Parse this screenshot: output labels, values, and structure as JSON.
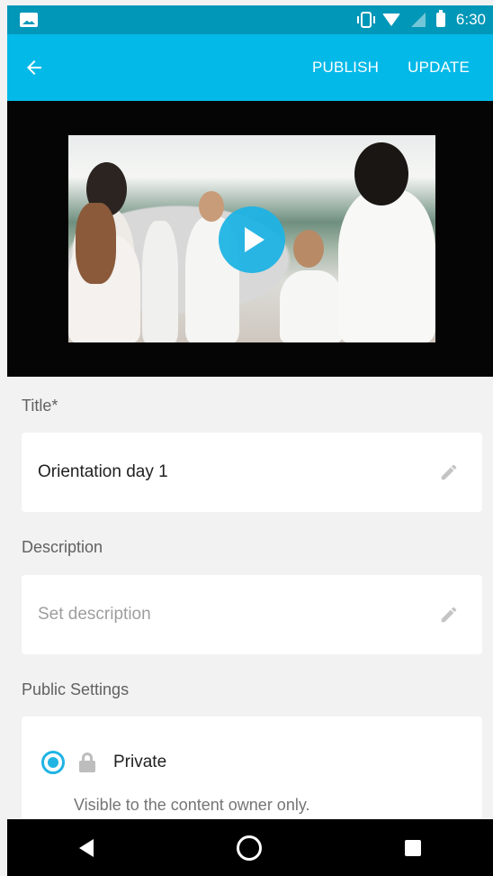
{
  "status_bar": {
    "time": "6:30",
    "icons": [
      "image-icon",
      "vibrate-icon",
      "wifi-icon",
      "no-signal-icon",
      "battery-icon"
    ]
  },
  "app_bar": {
    "back_icon": "arrow-back-icon",
    "publish_label": "PUBLISH",
    "update_label": "UPDATE",
    "color": "#03b9e8"
  },
  "video": {
    "play_icon": "play-icon",
    "play_color": "#1fb4e4"
  },
  "title_section": {
    "label": "Title*",
    "value": "Orientation day 1",
    "edit_icon": "pencil-icon"
  },
  "description_section": {
    "label": "Description",
    "placeholder": "Set description",
    "edit_icon": "pencil-icon"
  },
  "public_settings": {
    "label": "Public Settings",
    "option_label": "Private",
    "option_description": "Visible to the content owner only.",
    "selected": true,
    "icon": "lock-icon"
  },
  "nav_bar": {
    "icons": [
      "nav-back-icon",
      "nav-home-icon",
      "nav-recents-icon"
    ]
  }
}
